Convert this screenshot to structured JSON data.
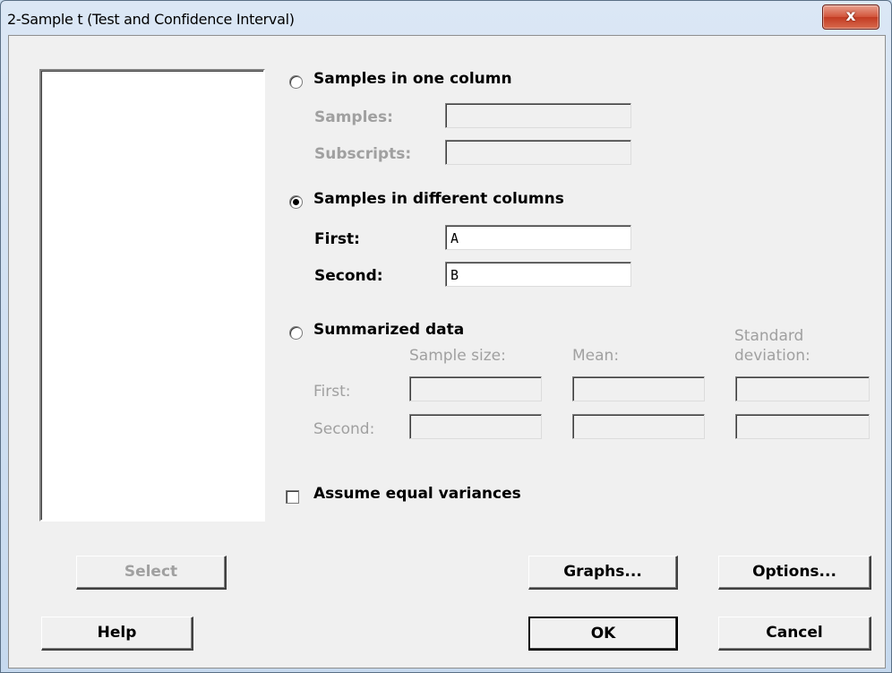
{
  "window": {
    "title": "2-Sample t (Test and Confidence Interval)",
    "close_glyph": "x"
  },
  "one_column": {
    "label": "Samples in one column",
    "samples_label": "Samples:",
    "samples_value": "",
    "subscripts_label": "Subscripts:",
    "subscripts_value": ""
  },
  "different_columns": {
    "label": "Samples in different columns",
    "first_label": "First:",
    "first_value": "A",
    "second_label": "Second:",
    "second_value": "B"
  },
  "summarized": {
    "label": "Summarized data",
    "col_sample_size": "Sample size:",
    "col_mean": "Mean:",
    "col_std_line1": "Standard",
    "col_std_line2": "deviation:",
    "first_label": "First:",
    "second_label": "Second:"
  },
  "options": {
    "equal_var_label": "Assume equal variances",
    "equal_var_checked": false
  },
  "buttons": {
    "select": "Select",
    "help": "Help",
    "graphs": "Graphs...",
    "options": "Options...",
    "ok": "OK",
    "cancel": "Cancel"
  },
  "selected_mode": "different_columns"
}
